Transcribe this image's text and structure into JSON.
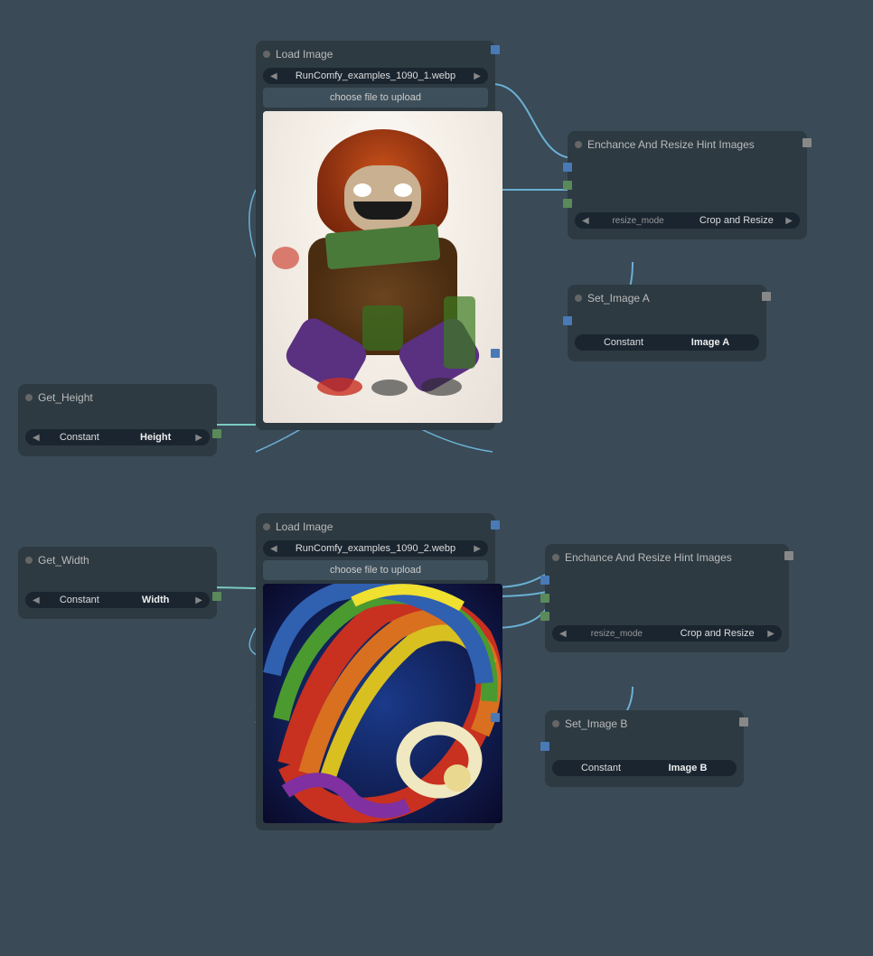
{
  "nodes": {
    "load_image_1": {
      "title": "Load Image",
      "file": "RunComfy_examples_1090_1.webp",
      "upload_btn": "choose file to upload"
    },
    "load_image_2": {
      "title": "Load Image",
      "file": "RunComfy_examples_1090_2.webp",
      "upload_btn": "choose file to upload"
    },
    "enhance_resize_1": {
      "title": "Enchance And Resize Hint Images",
      "resize_mode_label": "resize_mode",
      "resize_mode_value": "Crop and Resize"
    },
    "enhance_resize_2": {
      "title": "Enchance And Resize Hint Images",
      "resize_mode_label": "resize_mode",
      "resize_mode_value": "Crop and Resize"
    },
    "set_image_a": {
      "title": "Set_Image A",
      "label1": "Constant",
      "label2": "Image A"
    },
    "set_image_b": {
      "title": "Set_Image B",
      "label1": "Constant",
      "label2": "Image B"
    },
    "get_height": {
      "title": "Get_Height",
      "label": "Constant",
      "value": "Height"
    },
    "get_width": {
      "title": "Get_Width",
      "label": "Constant",
      "value": "Width"
    }
  },
  "colors": {
    "bg": "#3a4a56",
    "node_bg": "#2d3a42",
    "connector_blue": "#4a7ab5",
    "connector_green": "#5a8a5a",
    "connector_teal": "#4ab5a0",
    "line_blue": "#6ab0d4",
    "line_teal": "#7accc0"
  }
}
